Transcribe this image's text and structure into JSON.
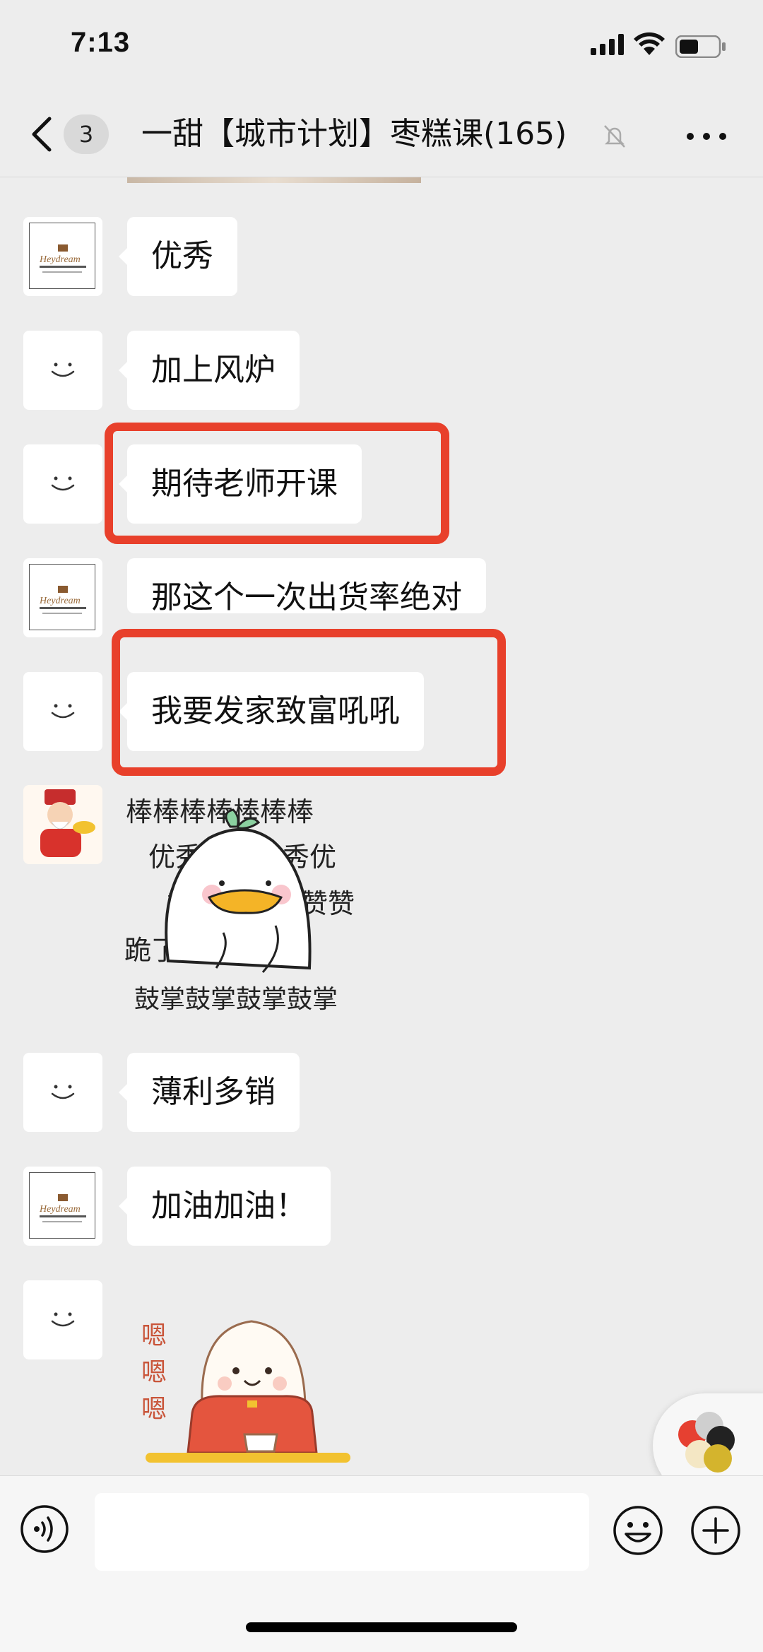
{
  "status_bar": {
    "time": "7:13"
  },
  "header": {
    "unread_count": "3",
    "title": "一甜【城市计划】枣糕课(165)"
  },
  "messages": [
    {
      "sender": "logo",
      "text": "优秀"
    },
    {
      "sender": "smiley",
      "text": "加上风炉"
    },
    {
      "sender": "smiley",
      "text": "期待老师开课",
      "highlighted": true
    },
    {
      "sender": "logo",
      "text": "那这个一次出货率绝对"
    },
    {
      "sender": "smiley",
      "text": "我要发家致富吼吼",
      "highlighted": true
    },
    {
      "sender": "god-of-wealth",
      "sticker": "duck-applause"
    },
    {
      "sender": "smiley",
      "text": "薄利多销"
    },
    {
      "sender": "logo",
      "text": "加油加油！"
    },
    {
      "sender": "smiley",
      "sticker": "seal-tea"
    }
  ],
  "stickers": {
    "duck_rows": [
      "棒棒棒棒棒棒棒",
      "优秀优秀优秀优",
      "赞赞赞赞赞赞赞",
      "跪了跪了跪了",
      "鼓掌鼓掌鼓掌鼓掌"
    ],
    "seal_text": [
      "嗯",
      "嗯",
      "嗯"
    ]
  },
  "logo_text": "Heydream",
  "input": {
    "placeholder": ""
  },
  "colors": {
    "highlight": "#e8402b",
    "background": "#ededed",
    "bubble": "#ffffff"
  }
}
